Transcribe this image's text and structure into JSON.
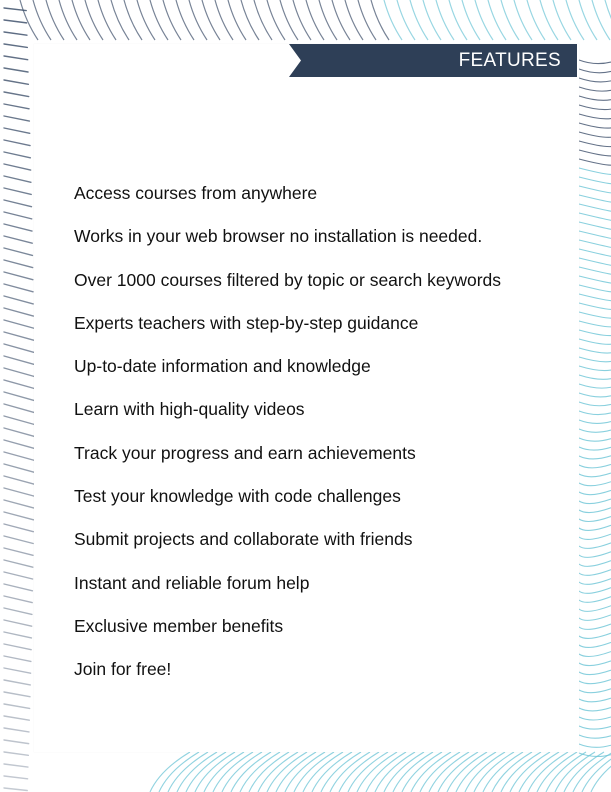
{
  "banner": {
    "title": "FEATURES",
    "color": "#2e3f57"
  },
  "decoration": {
    "stroke_dark": "#3d4f6a",
    "stroke_teal": "#6cc4d6"
  },
  "features": [
    "Access courses from anywhere",
    "Works in your web browser no installation is needed.",
    "Over 1000 courses filtered by topic or search keywords",
    "Experts teachers with step-by-step guidance",
    "Up-to-date information and knowledge",
    "Learn with high-quality videos",
    "Track your progress and earn achievements",
    "Test your knowledge with code challenges",
    "Submit projects and collaborate with friends",
    "Instant and reliable forum help",
    "Exclusive member benefits",
    "Join for free!"
  ]
}
